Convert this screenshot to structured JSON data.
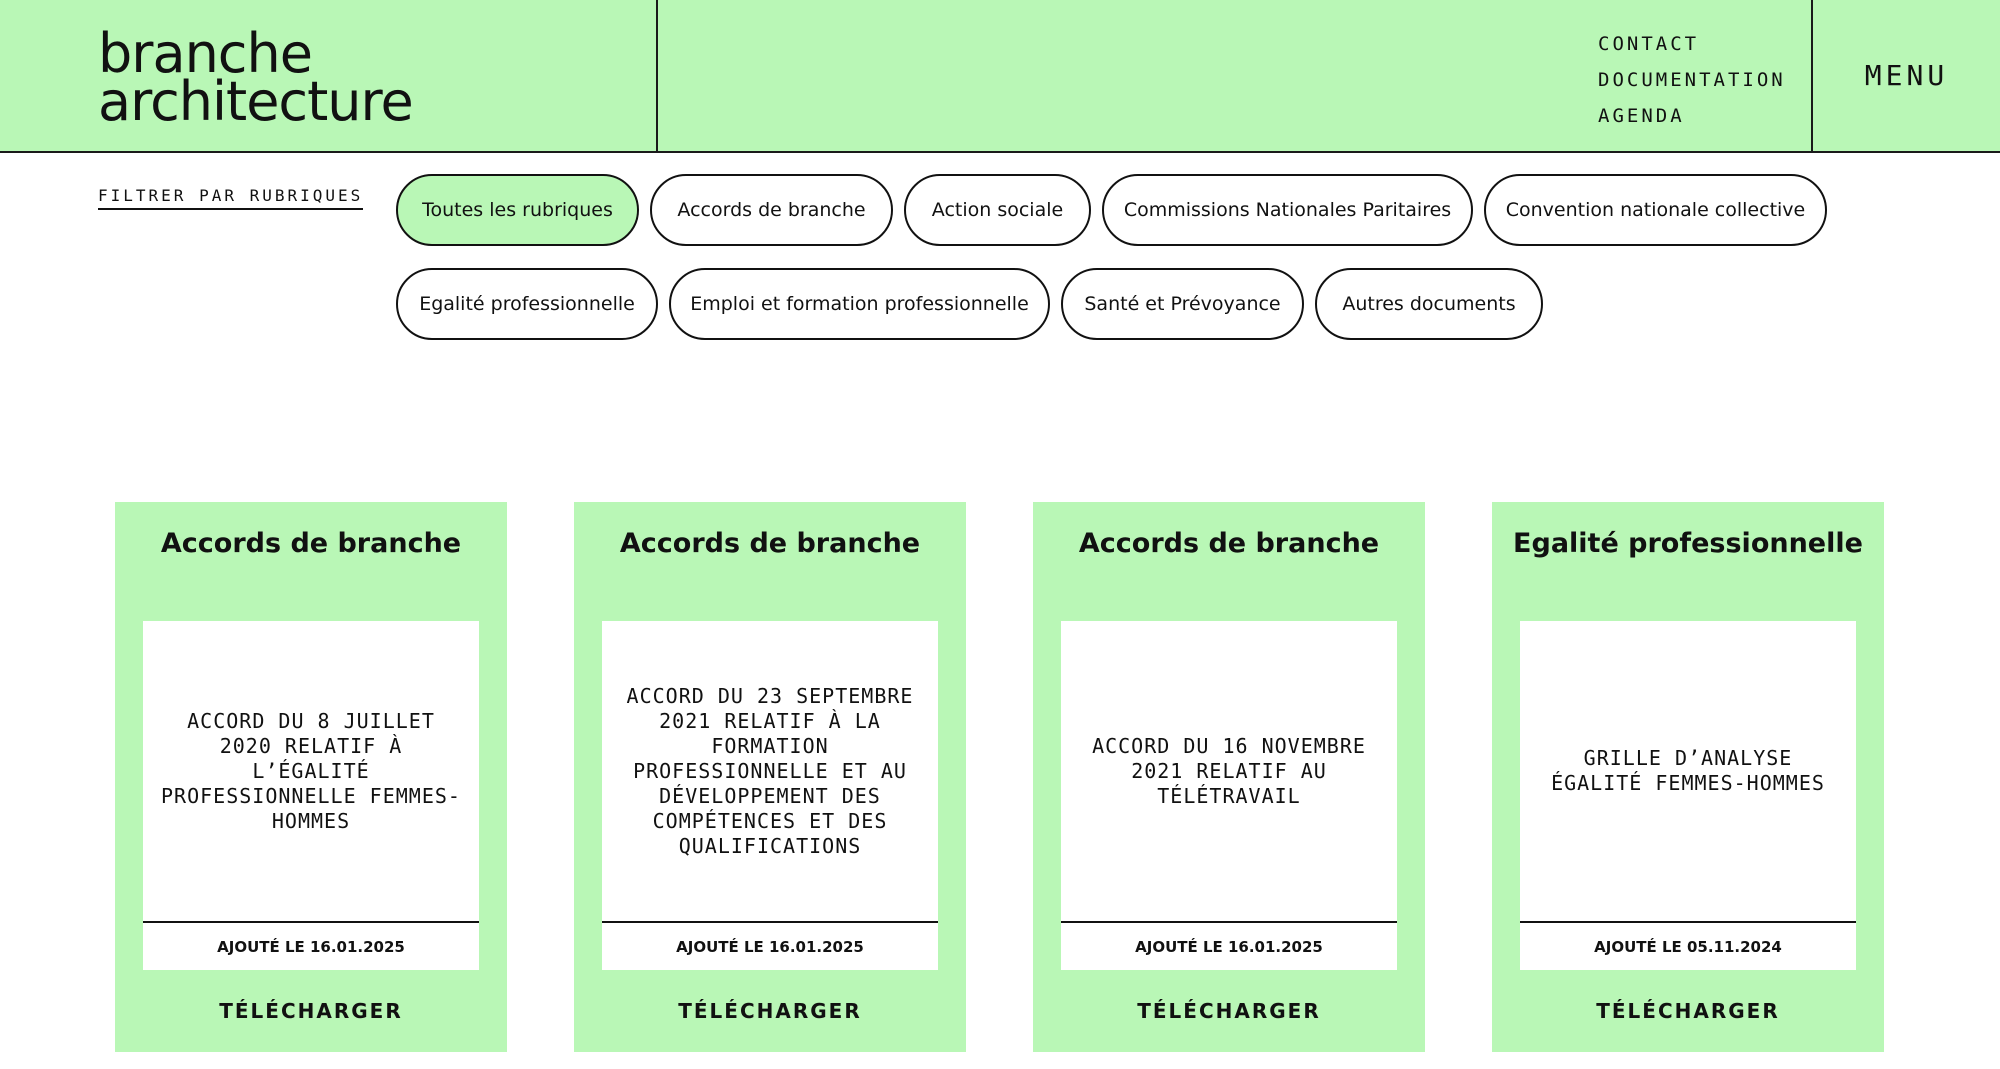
{
  "header": {
    "logo_line1": "branche",
    "logo_line2": "architecture",
    "links": [
      "CONTACT",
      "DOCUMENTATION",
      "AGENDA"
    ],
    "menu_label": "MENU"
  },
  "filters": {
    "label": "FILTRER PAR RUBRIQUES",
    "pills": [
      {
        "label": "Toutes les rubriques",
        "active": true
      },
      {
        "label": "Accords de branche",
        "active": false
      },
      {
        "label": "Action sociale",
        "active": false
      },
      {
        "label": "Commissions Nationales Paritaires",
        "active": false
      },
      {
        "label": "Convention nationale collective",
        "active": false
      },
      {
        "label": "Egalité professionnelle",
        "active": false
      },
      {
        "label": "Emploi et formation professionnelle",
        "active": false
      },
      {
        "label": "Santé et Prévoyance",
        "active": false
      },
      {
        "label": "Autres documents",
        "active": false
      }
    ]
  },
  "cards": [
    {
      "category": "Accords de branche",
      "document_title": "ACCORD DU 8 JUILLET 2020 RELATIF À L’ÉGALITÉ PROFESSIONNELLE FEMMES-HOMMES",
      "date_label": "AJOUTÉ LE 16.01.2025",
      "download_label": "TÉLÉCHARGER"
    },
    {
      "category": "Accords de branche",
      "document_title": "ACCORD DU 23 SEPTEMBRE 2021 RELATIF À LA FORMATION PROFESSIONNELLE ET AU DÉVELOPPEMENT DES COMPÉTENCES ET DES QUALIFICATIONS",
      "date_label": "AJOUTÉ LE 16.01.2025",
      "download_label": "TÉLÉCHARGER"
    },
    {
      "category": "Accords de branche",
      "document_title": "ACCORD DU 16 NOVEMBRE 2021 RELATIF AU TÉLÉTRAVAIL",
      "date_label": "AJOUTÉ LE 16.01.2025",
      "download_label": "TÉLÉCHARGER"
    },
    {
      "category": "Egalité professionnelle",
      "document_title": "GRILLE D’ANALYSE ÉGALITÉ FEMMES-HOMMES",
      "date_label": "AJOUTÉ LE 05.11.2024",
      "download_label": "TÉLÉCHARGER"
    }
  ],
  "colors": {
    "accent_green": "#b9f7b6",
    "ink": "#111111"
  }
}
